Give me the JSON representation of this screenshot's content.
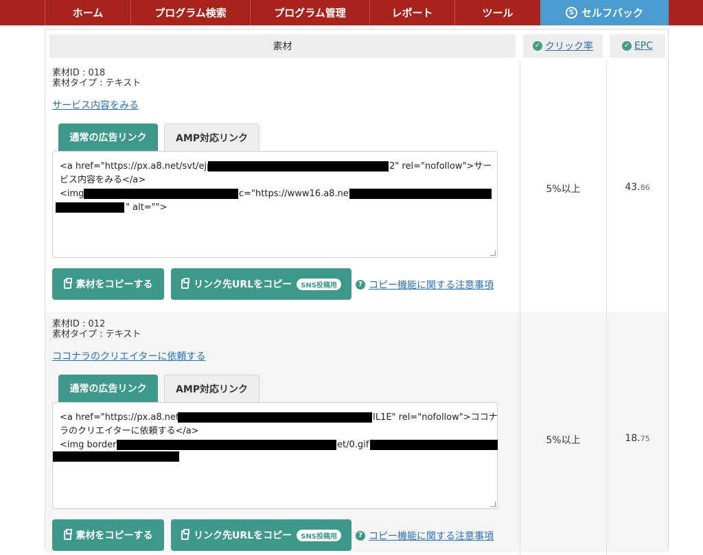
{
  "nav": {
    "items": [
      "ホーム",
      "プログラム検索",
      "プログラム管理",
      "レポート",
      "ツール"
    ],
    "selfback": "セルフバック",
    "selfback_icon": "S"
  },
  "table": {
    "col_material": "素材",
    "col_click_rate": "クリック率",
    "col_epc": "EPC"
  },
  "rows": [
    {
      "id_line": "素材ID : 018",
      "type_line": "素材タイプ : テキスト",
      "service_link": "サービス内容をみる",
      "tab_normal": "通常の広告リンク",
      "tab_amp": "AMP対応リンク",
      "code_lines": [
        "<a href=\"https://px.a8.net/svt/ejp",
        "2\" rel=\"nofollow\">サー",
        "ビス内容をみる</a>",
        "<img",
        "c=\"https://www16.a8.net/",
        "\" alt=\"\">"
      ],
      "copy_button": "素材をコピーする",
      "copy_url_button": "リンク先URLをコピー",
      "sns_badge": "SNS投稿用",
      "notice": "コピー機能に関する注意事項",
      "click_rate": "5%以上",
      "epc_int": "43.",
      "epc_dec": "86"
    },
    {
      "id_line": "素材ID : 012",
      "type_line": "素材タイプ : テキスト",
      "service_link": "ココナラのクリエイターに依頼する",
      "tab_normal": "通常の広告リンク",
      "tab_amp": "AMP対応リンク",
      "code_lines": [
        "<a href=\"https://px.a8.net/",
        "IL1E\" rel=\"nofollow\">ココナ",
        "ラのクリエイターに依頼する</a>",
        "<img border=",
        "et/0.gif"
      ],
      "copy_button": "素材をコピーする",
      "copy_url_button": "リンク先URLをコピー",
      "sns_badge": "SNS投稿用",
      "notice": "コピー機能に関する注意事項",
      "click_rate": "5%以上",
      "epc_int": "18.",
      "epc_dec": "75"
    }
  ],
  "icons": {
    "check": "✓",
    "question": "?"
  },
  "colors": {
    "nav_bg": "#a8231c",
    "nav_active": "#4a9bcf",
    "button_green": "#3f998a",
    "link_blue": "#2a6fb5"
  }
}
